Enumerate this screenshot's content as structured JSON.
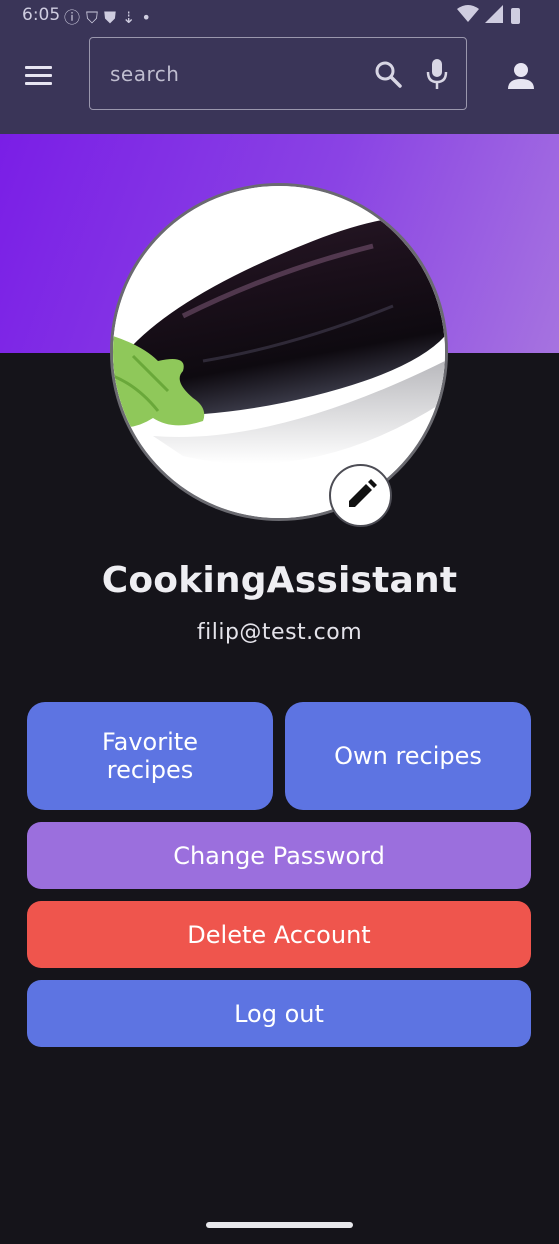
{
  "status_bar": {
    "time": "6:05",
    "left_icons": [
      "info-icon",
      "shield-icon",
      "shield-filled-icon",
      "download-icon",
      "dot-icon"
    ],
    "right_icons": [
      "wifi-icon",
      "signal-icon",
      "battery-icon"
    ]
  },
  "app_bar": {
    "search_placeholder": "search"
  },
  "profile": {
    "username": "CookingAssistant",
    "email": "filip@test.com"
  },
  "buttons": {
    "favorite_recipes": "Favorite recipes",
    "own_recipes": "Own recipes",
    "change_password": "Change Password",
    "delete_account": "Delete Account",
    "log_out": "Log out"
  },
  "colors": {
    "app_bar": "#3a3558",
    "background": "#15141a",
    "primary_button": "#5d74e2",
    "change_password_button": "#9b6fdd",
    "delete_button": "#ef554d",
    "banner_start": "#7a1ee6",
    "banner_end": "#a673e0"
  }
}
